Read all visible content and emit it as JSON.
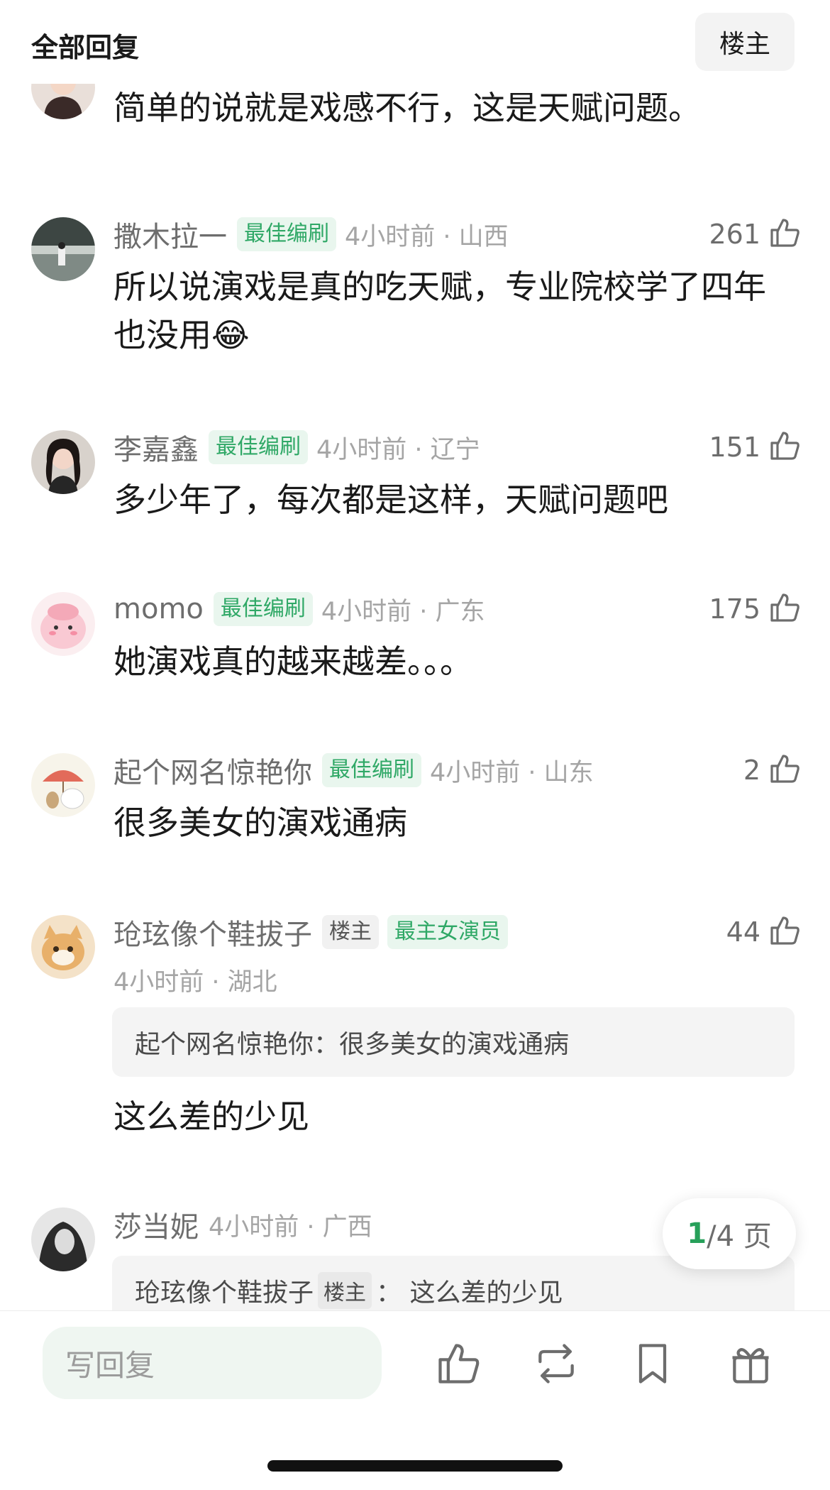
{
  "header": {
    "title": "全部回复",
    "filter_button": "楼主"
  },
  "comments": [
    {
      "username": "",
      "text": "简单的说就是戏感不行，这是天赋问题。"
    },
    {
      "username": "撒木拉一",
      "badge": "最佳编刷",
      "time": "4小时前 · 山西",
      "likes": "261",
      "text": "所以说演戏是真的吃天赋，专业院校学了四年也没用😂"
    },
    {
      "username": "李嘉鑫",
      "badge": "最佳编刷",
      "time": "4小时前 · 辽宁",
      "likes": "151",
      "text": "多少年了，每次都是这样，天赋问题吧"
    },
    {
      "username": "momo",
      "badge": "最佳编刷",
      "time": "4小时前 · 广东",
      "likes": "175",
      "text": "她演戏真的越来越差。。。"
    },
    {
      "username": "起个网名惊艳你",
      "badge": "最佳编刷",
      "time": "4小时前 · 山东",
      "likes": "2",
      "text": "很多美女的演戏通病"
    },
    {
      "username": "玱玹像个鞋拔子",
      "badge_op": "楼主",
      "badge": "最主女演员",
      "time": "4小时前 · 湖北",
      "likes": "44",
      "quote": "起个网名惊艳你：很多美女的演戏通病",
      "text": "这么差的少见"
    },
    {
      "username": "莎当妮",
      "time": "4小时前 · 广西",
      "quote_user": "玱玹像个鞋拔子",
      "quote_badge": "楼主",
      "quote_text": "： 这么差的少见"
    }
  ],
  "pager": {
    "current": "1",
    "total": "/4 页"
  },
  "bottom_bar": {
    "reply_placeholder": "写回复"
  }
}
